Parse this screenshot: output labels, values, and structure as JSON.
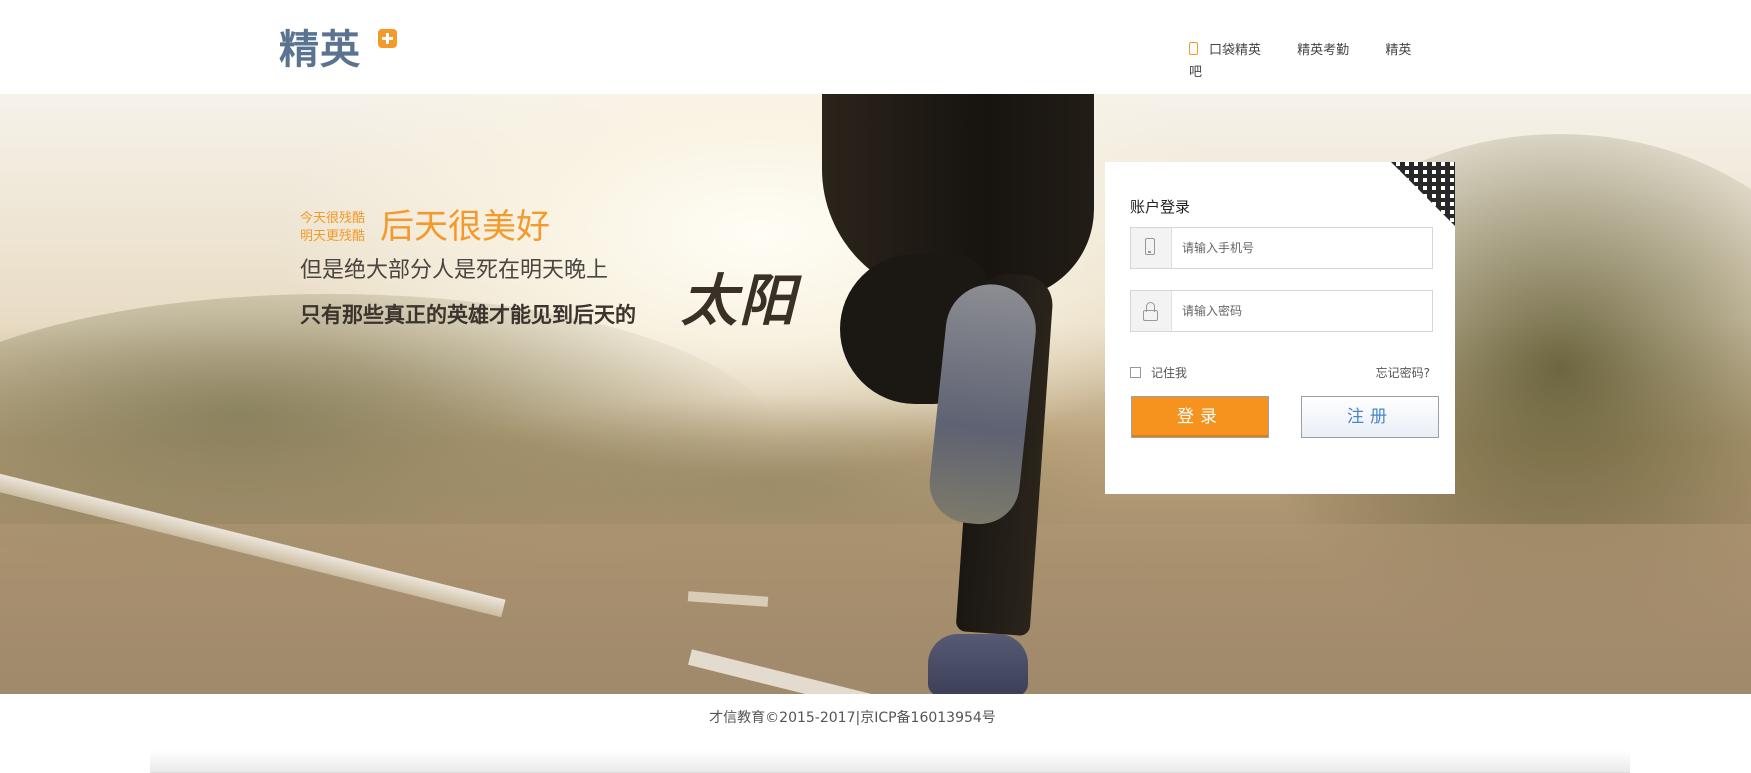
{
  "header": {
    "logo_text": "精英",
    "nav": [
      {
        "label": "口袋精英",
        "icon": "mobile-phone-icon"
      },
      {
        "label": "精英考勤"
      },
      {
        "label": "精英吧"
      }
    ]
  },
  "hero": {
    "slogan_small_line1": "今天很残酷",
    "slogan_small_line2": "明天更残酷",
    "slogan_big": "后天很美好",
    "slogan_line2": "但是绝大部分人是死在明天晚上",
    "slogan_line3": "只有那些真正的英雄才能见到后天的",
    "slogan_brush": "太阳",
    "accent_color": "#f39a2a"
  },
  "login": {
    "title": "账户登录",
    "phone_placeholder": "请输入手机号",
    "password_placeholder": "请输入密码",
    "remember_label": "记住我",
    "remember_checked": false,
    "forgot_label": "忘记密码?",
    "login_button": "登录",
    "register_button": "注册",
    "login_button_color": "#f6921e",
    "register_text_color": "#4a87c8"
  },
  "footer": {
    "copyright": "才信教育©2015-2017|京ICP备16013954号"
  }
}
